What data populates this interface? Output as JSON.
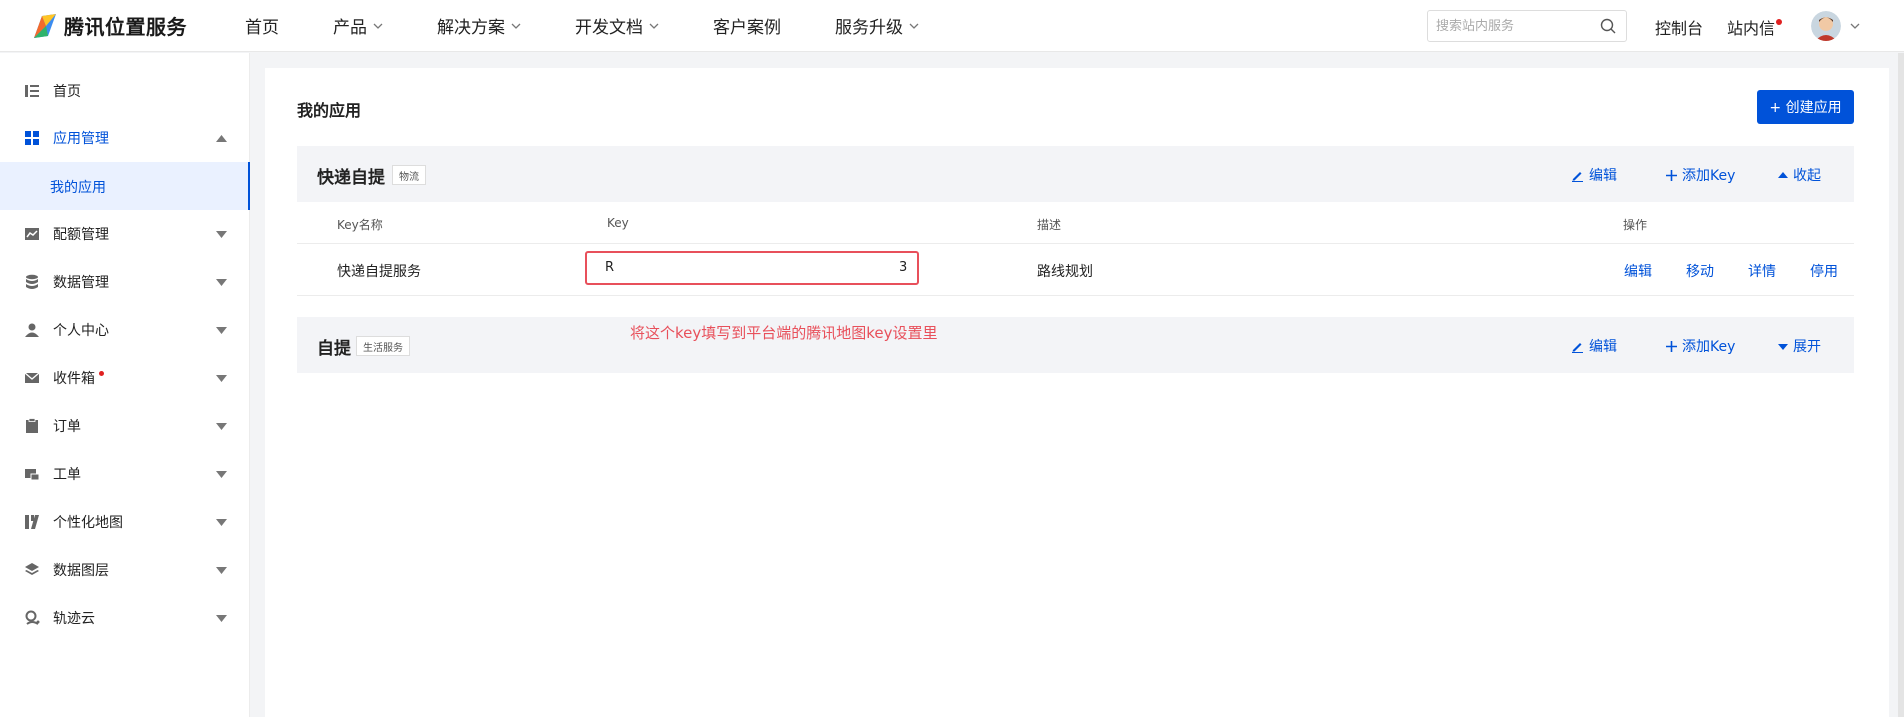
{
  "brand": {
    "name": "腾讯位置服务"
  },
  "nav": {
    "items": [
      {
        "label": "首页",
        "has_dropdown": false
      },
      {
        "label": "产品",
        "has_dropdown": true
      },
      {
        "label": "解决方案",
        "has_dropdown": true
      },
      {
        "label": "开发文档",
        "has_dropdown": true
      },
      {
        "label": "客户案例",
        "has_dropdown": false
      },
      {
        "label": "服务升级",
        "has_dropdown": true
      }
    ],
    "search_placeholder": "搜索站内服务",
    "console_label": "控制台",
    "inbox_label": "站内信"
  },
  "sidebar": {
    "items": [
      {
        "label": "首页",
        "icon": "list-icon"
      },
      {
        "label": "应用管理",
        "icon": "grid-icon",
        "active": true,
        "expanded": true
      },
      {
        "label": "配额管理",
        "icon": "chart-icon"
      },
      {
        "label": "数据管理",
        "icon": "database-icon"
      },
      {
        "label": "个人中心",
        "icon": "user-icon"
      },
      {
        "label": "收件箱",
        "icon": "mail-icon",
        "unread": true
      },
      {
        "label": "订单",
        "icon": "clipboard-icon"
      },
      {
        "label": "工单",
        "icon": "ticket-icon"
      },
      {
        "label": "个性化地图",
        "icon": "map-style-icon"
      },
      {
        "label": "数据图层",
        "icon": "layers-icon"
      },
      {
        "label": "轨迹云",
        "icon": "track-icon"
      }
    ],
    "sub_item": {
      "label": "我的应用"
    }
  },
  "main": {
    "title": "我的应用",
    "create_button": "+ 创建应用",
    "apps": [
      {
        "name": "快递自提",
        "tag": "物流",
        "actions": {
          "edit": "编辑",
          "add_key": "添加Key",
          "toggle": "收起"
        },
        "columns": [
          "Key名称",
          "Key",
          "描述",
          "操作"
        ],
        "rows": [
          {
            "key_name": "快递自提服务",
            "key_start": "R",
            "key_end": "3",
            "description": "路线规划",
            "ops": [
              "编辑",
              "移动",
              "详情",
              "停用"
            ]
          }
        ]
      },
      {
        "name": "自提",
        "tag": "生活服务",
        "actions": {
          "edit": "编辑",
          "add_key": "添加Key",
          "toggle": "展开"
        }
      }
    ],
    "annotation": "将这个key填写到平台端的腾讯地图key设置里"
  },
  "colors": {
    "primary": "#0052d9",
    "annotation": "#e8505b",
    "unread_dot": "#e02020"
  }
}
